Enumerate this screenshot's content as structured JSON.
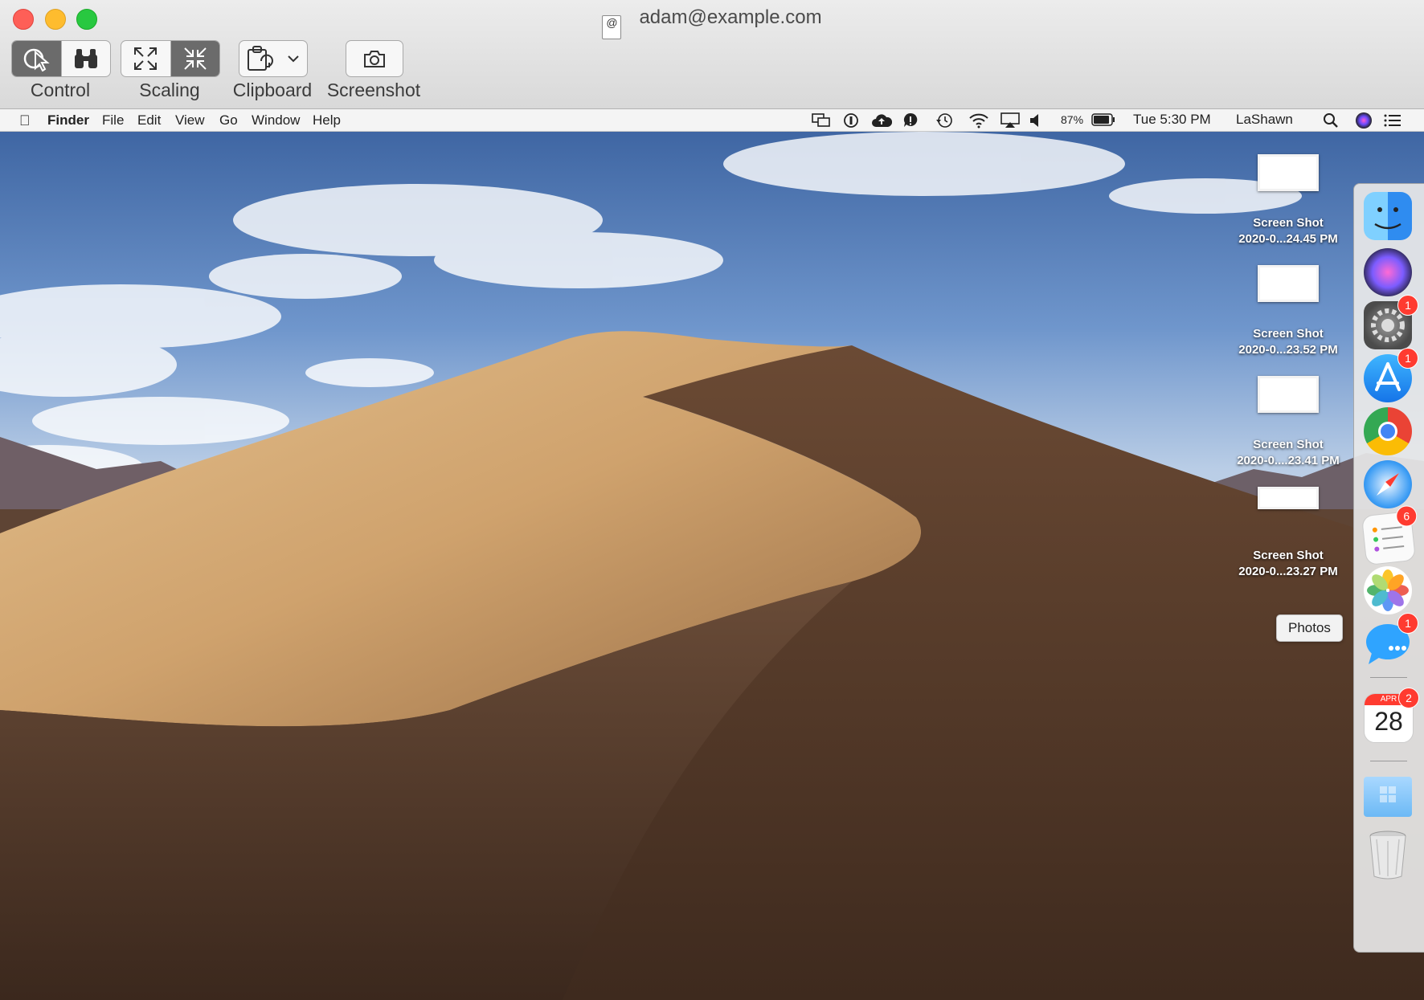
{
  "window": {
    "title": "adam@example.com",
    "doc_icon": "@"
  },
  "toolbar": {
    "control_label": "Control",
    "scaling_label": "Scaling",
    "clipboard_label": "Clipboard",
    "screenshot_label": "Screenshot"
  },
  "menubar": {
    "app_name": "Finder",
    "items": [
      "File",
      "Edit",
      "View",
      "Go",
      "Window",
      "Help"
    ],
    "battery": "87%",
    "clock": "Tue 5:30 PM",
    "user": "LaShawn"
  },
  "desktop": {
    "files": [
      {
        "line1": "Screen Shot",
        "line2": "2020-0...24.45 PM"
      },
      {
        "line1": "Screen Shot",
        "line2": "2020-0...23.52 PM"
      },
      {
        "line1": "Screen Shot",
        "line2": "2020-0....23.41 PM"
      },
      {
        "line1": "Screen Shot",
        "line2": "2020-0...23.27 PM"
      }
    ]
  },
  "dock": {
    "tooltip": "Photos",
    "badges": {
      "system_preferences": "1",
      "app_store": "1",
      "reminders": "6",
      "messages": "1",
      "calendar": "2"
    },
    "calendar_month": "APR",
    "calendar_day": "28"
  },
  "colors": {
    "close": "#fe5f57",
    "minimize": "#febc2e",
    "maximize": "#28c840",
    "badge": "#ff3b30"
  }
}
